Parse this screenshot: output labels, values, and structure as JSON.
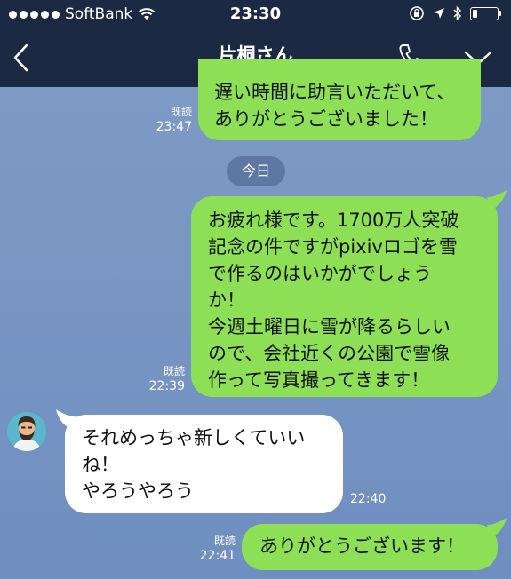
{
  "status_bar": {
    "carrier": "SoftBank",
    "time": "23:30"
  },
  "header": {
    "title": "片桐さん",
    "page_index": 0,
    "page_count": 3
  },
  "date_separator": "今日",
  "messages": [
    {
      "direction": "sent",
      "read_label": "既読",
      "time": "23:47",
      "lines": [
        "遅い時間に助言いただいて、",
        "ありがとうございました！"
      ]
    },
    {
      "direction": "sent",
      "read_label": "既読",
      "time": "22:39",
      "lines": [
        "お疲れ様です。1700万人突破",
        "記念の件ですがpixivロゴを雪",
        "で作るのはいかがでしょう",
        "か！",
        "今週土曜日に雪が降るらしい",
        "ので、会社近くの公園で雪像",
        "作って写真撮ってきます！"
      ]
    },
    {
      "direction": "received",
      "time": "22:40",
      "lines": [
        "それめっちゃ新しくていい",
        "ね！",
        "やろうやろう"
      ]
    },
    {
      "direction": "sent",
      "read_label": "既読",
      "time": "22:41",
      "lines": [
        "ありがとうございます！"
      ]
    }
  ],
  "colors": {
    "header_bg": "#1c2942",
    "sent_bubble": "#8de055",
    "received_bubble": "#ffffff",
    "chat_bg": "#7a97c4"
  }
}
